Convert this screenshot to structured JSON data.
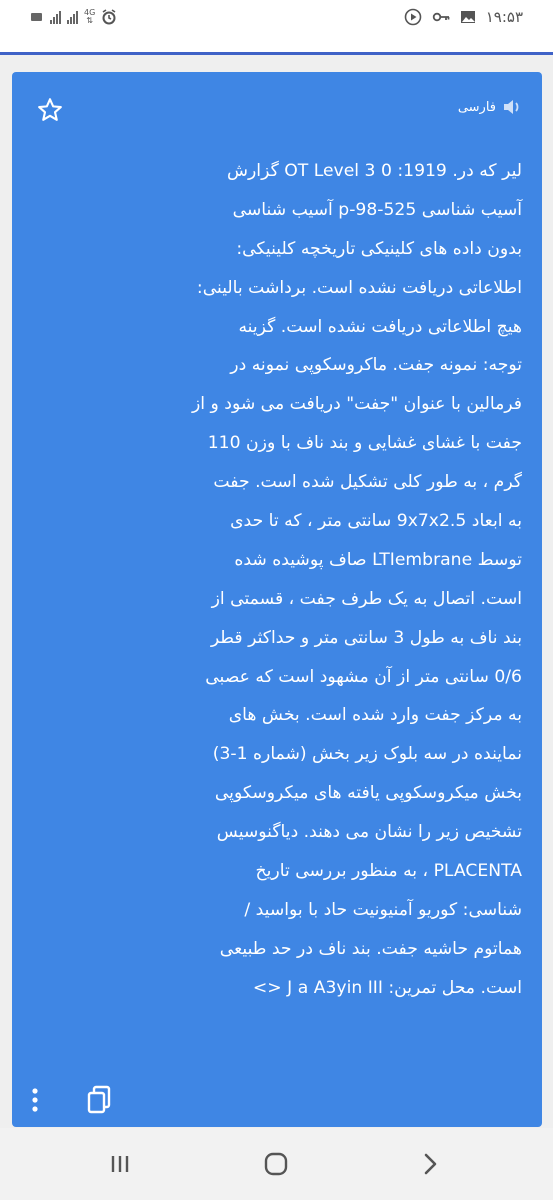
{
  "status_bar": {
    "network": "4G",
    "time": "۱۹:۵۳",
    "colors": {
      "background": "#ffffff",
      "icons": "#555555"
    }
  },
  "translation": {
    "language_label": "فارسی",
    "lines": [
      "لیر که در. OT Level 3 0 :1919 گزارش",
      "آسیب شناسی p-98-525 آسیب شناسی",
      "بدون داده های کلینیکی تاریخچه کلینیکی:",
      "اطلاعاتی دریافت نشده است. برداشت بالینی:",
      "هیچ اطلاعاتی دریافت نشده است. گزینه",
      "توجه: نمونه جفت. ماکروسکوپی نمونه در",
      "فرمالین با عنوان \"جفت\" دریافت می شود و از",
      "جفت با غشای غشایی و بند ناف با وزن 110",
      "گرم ، به طور کلی تشکیل شده است. جفت",
      "به ابعاد 9x7x2.5 سانتی متر ، که تا حدی",
      "توسط LTIembrane صاف پوشیده شده",
      "است. اتصال به یک طرف جفت ، قسمتی از",
      "بند ناف به طول 3 سانتی متر و حداکثر قطر",
      "0/6 سانتی متر از آن مشهود است که عصبی",
      "به مرکز جفت وارد شده است. بخش های",
      "نماینده در سه بلوک زیر بخش (شماره 1-3)",
      "بخش میکروسکوپی یافته های میکروسکوپی",
      "تشخیص زیر را نشان می دهند. دیاگنوسیس",
      "PLACENTA ، به منظور بررسی تاریخ",
      "شناسی: کوریو آمنیونیت حاد با بواسید /",
      "هماتوم حاشیه جفت. بند ناف در حد طبیعی",
      "است. محل تمرین: J a A3yin III <>"
    ]
  },
  "colors": {
    "card": "#3f86e4",
    "text": "#ffffff",
    "accent_bar": "#3f62c7",
    "page": "#efefef"
  },
  "icons": {
    "star": "star-outline-icon",
    "speaker": "speaker-icon",
    "more": "more-vert-icon",
    "copy": "copy-icon"
  }
}
